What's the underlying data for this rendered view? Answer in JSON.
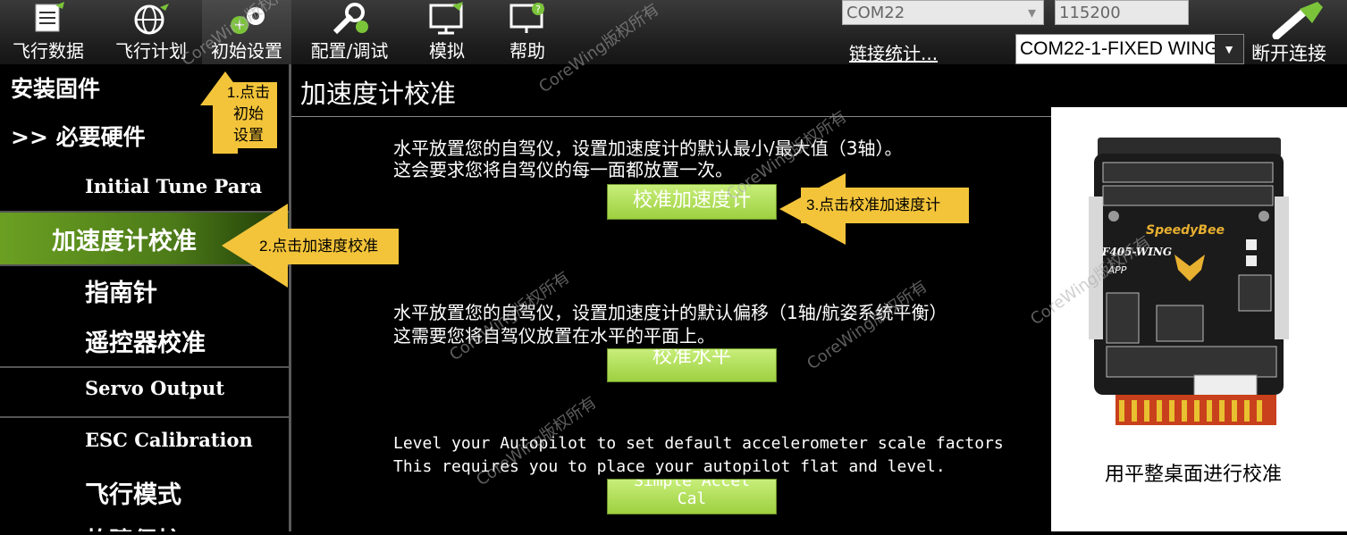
{
  "toolbar": {
    "items": [
      {
        "label": "飞行数据",
        "icon": "flight-data-icon"
      },
      {
        "label": "飞行计划",
        "icon": "globe-icon"
      },
      {
        "label": "初始设置",
        "icon": "initial-setup-icon"
      },
      {
        "label": "配置/调试",
        "icon": "wrench-icon"
      },
      {
        "label": "模拟",
        "icon": "monitor-icon"
      },
      {
        "label": "帮助",
        "icon": "help-icon"
      }
    ],
    "com_port": "COM22",
    "baud_rate": "115200",
    "link_stats": "链接统计...",
    "connection_select": "COM22-1-FIXED WING",
    "disconnect": "断开连接"
  },
  "sidebar": {
    "install_firmware": "安装固件",
    "mandatory_hardware": ">> 必要硬件",
    "items": [
      "Initial Tune Para",
      "加速度计校准",
      "指南针",
      "遥控器校准",
      "Servo Output",
      "ESC Calibration",
      "飞行模式",
      "故障保护"
    ]
  },
  "main": {
    "title": "加速度计校准",
    "text1_line1": "水平放置您的自驾仪，设置加速度计的默认最小/最大值（3轴）。",
    "text1_line2": "这会要求您将自驾仪的每一面都放置一次。",
    "btn1": "校准加速度计",
    "text2_line1": "水平放置您的自驾仪，设置加速度计的默认偏移（1轴/航姿系统平衡）",
    "text2_line2": "这需要您将自驾仪放置在水平的平面上。",
    "btn2": "校准水平",
    "text3_line1": "Level your Autopilot to set default accelerometer scale factors",
    "text3_line2": "This requires you to place your autopilot flat and level.",
    "btn3_line1": "Simple Accel",
    "btn3_line2": "Cal"
  },
  "callouts": {
    "c1": "1.点击初始设置",
    "c1_l1": "1.点击",
    "c1_l2": "初始",
    "c1_l3": "设置",
    "c2": "2.点击加速度校准",
    "c3": "3.点击校准加速度计"
  },
  "photo": {
    "caption": "用平整桌面进行校准",
    "board_brand": "SpeedyBee",
    "board_model": "F405-WING",
    "board_app": "APP"
  },
  "watermark": "CoreWing版权所有",
  "colors": {
    "accent_green": "#9ed040",
    "callout_yellow": "#f3c43a",
    "sidebar_active": "#6aa022"
  }
}
